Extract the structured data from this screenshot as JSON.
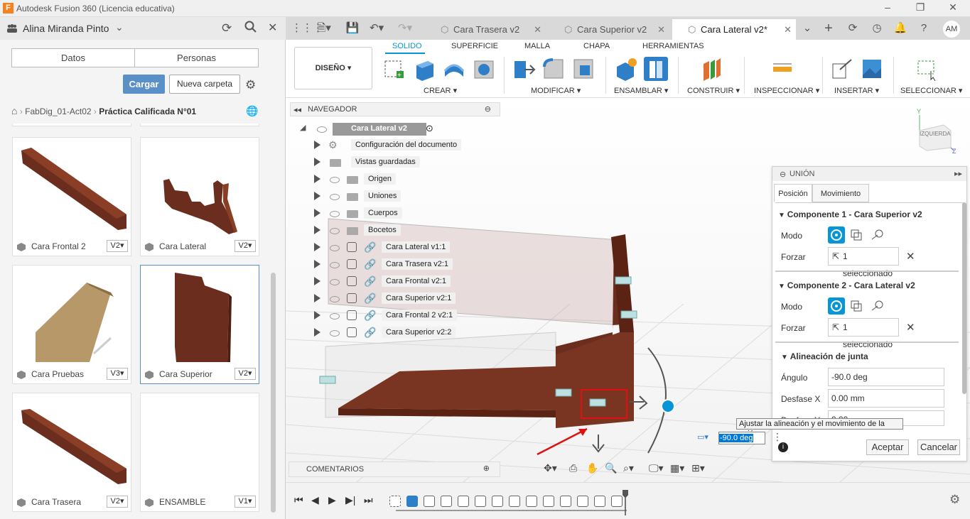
{
  "app": {
    "title": "Autodesk Fusion 360 (Licencia educativa)"
  },
  "left_panel": {
    "user_name": "Alina Miranda Pinto",
    "tabs": [
      "Datos",
      "Personas"
    ],
    "upload_label": "Cargar",
    "new_folder_label": "Nueva carpeta",
    "breadcrumb": {
      "project": "FabDig_01-Act02",
      "folder": "Práctica Calificada N°01"
    },
    "files": [
      {
        "name": "Cara Frontal 2",
        "version": "V2"
      },
      {
        "name": "Cara Lateral",
        "version": "V2"
      },
      {
        "name": "Cara Pruebas",
        "version": "V3"
      },
      {
        "name": "Cara Superior",
        "version": "V2"
      },
      {
        "name": "Cara Trasera",
        "version": "V2"
      },
      {
        "name": "ENSAMBLE",
        "version": "V1"
      }
    ]
  },
  "doc_tabs": [
    {
      "label": "Cara Trasera v2",
      "active": false
    },
    {
      "label": "Cara Superior v2",
      "active": false
    },
    {
      "label": "Cara Lateral v2*",
      "active": true
    }
  ],
  "user_initials": "AM",
  "toolbar": {
    "workspace": "DISEÑO",
    "tabs": [
      "SOLIDO",
      "SUPERFICIE",
      "MALLA",
      "CHAPA",
      "HERRAMIENTAS"
    ],
    "active_tab": "SOLIDO",
    "groups": [
      "CREAR",
      "MODIFICAR",
      "ENSAMBLAR",
      "CONSTRUIR",
      "INSPECCIONAR",
      "INSERTAR",
      "SELECCIONAR"
    ]
  },
  "navigator": {
    "title": "NAVEGADOR",
    "root": "Cara Lateral v2",
    "items": [
      "Configuración del documento",
      "Vistas guardadas",
      "Origen",
      "Uniones",
      "Cuerpos",
      "Bocetos",
      "Cara Lateral v1:1",
      "Cara Trasera v2:1",
      "Cara Frontal v2:1",
      "Cara Superior v2:1",
      "Cara Frontal 2 v2:1",
      "Cara Superior v2:2"
    ]
  },
  "comments_label": "COMENTARIOS",
  "viewcube_label": "IZQUIERDA",
  "union_dialog": {
    "title": "UNIÓN",
    "tabs": [
      "Posición",
      "Movimiento"
    ],
    "component1_title": "Componente 1 - Cara Superior v2",
    "component2_title": "Componente 2 - Cara Lateral v2",
    "mode_label": "Modo",
    "force_label": "Forzar",
    "selected_text": "1 seleccionado",
    "alignment_title": "Alineación de junta",
    "angle_label": "Ángulo",
    "angle_value": "-90.0 deg",
    "offset_x_label": "Desfase X",
    "offset_x_value": "0.00 mm",
    "offset_y_label": "Desfase Y",
    "offset_y_value": "0.00",
    "ok_label": "Aceptar",
    "cancel_label": "Cancelar"
  },
  "tooltip_text": "Ajustar la alineación y el movimiento de la unión",
  "angle_input_value": "-90.0 deg"
}
